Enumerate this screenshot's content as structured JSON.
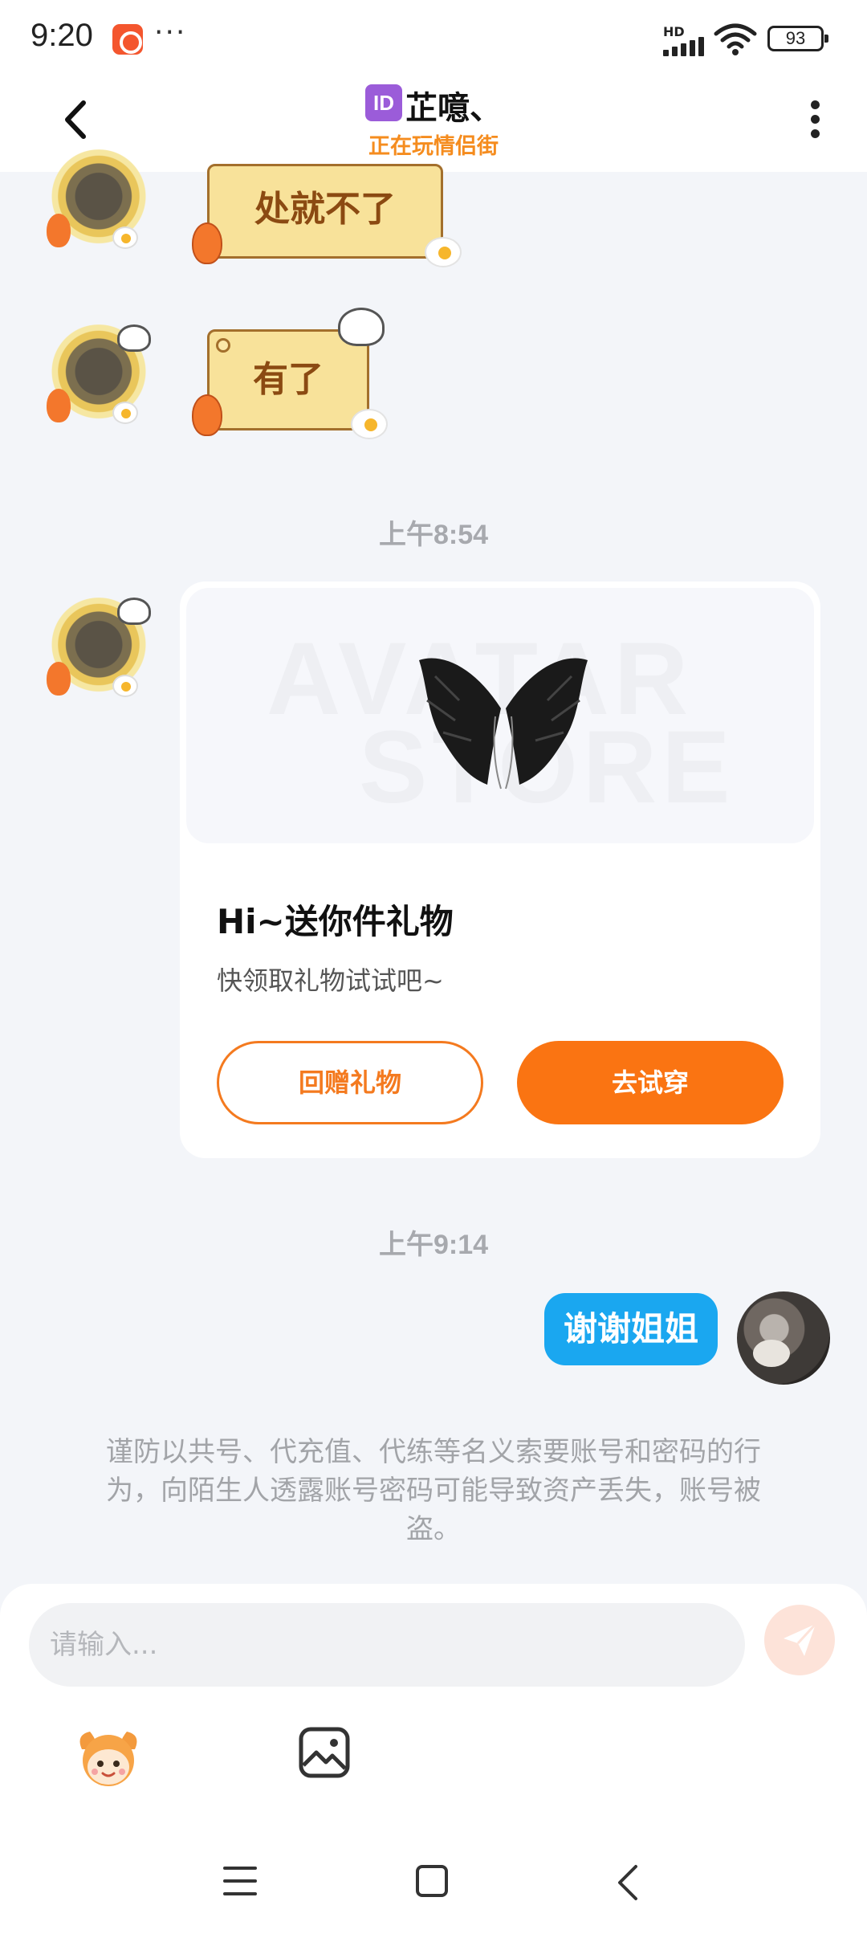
{
  "status_bar": {
    "time": "9:20",
    "more": "···",
    "network_label": "HD",
    "battery": "93"
  },
  "header": {
    "id_badge": "ID",
    "contact_name": "芷噫、",
    "contact_status": "正在玩情侣街"
  },
  "messages": {
    "sticker_1": "处就不了",
    "sticker_2": "有了",
    "time_1": "上午8:54",
    "gift_card": {
      "watermark_line_1": "AVATAR",
      "watermark_line_2": "STORE",
      "title": "Hi~送你件礼物",
      "subtitle": "快领取礼物试试吧~",
      "return_gift_label": "回赠礼物",
      "try_on_label": "去试穿"
    },
    "time_2": "上午9:14",
    "my_message": "谢谢姐姐",
    "warning": "谨防以共号、代充值、代练等名义索要账号和密码的行为，向陌生人透露账号密码可能导致资产丢失，账号被盗。"
  },
  "input": {
    "placeholder": "请输入..."
  },
  "colors": {
    "accent_orange": "#fa7412",
    "my_bubble_blue": "#1aa7f0",
    "status_orange": "#f58c1e"
  },
  "icons": {
    "back": "back-arrow-icon",
    "menu": "kebab-icon",
    "send": "paper-plane-icon",
    "emoji": "mascot-emoji-icon",
    "image": "image-icon"
  }
}
